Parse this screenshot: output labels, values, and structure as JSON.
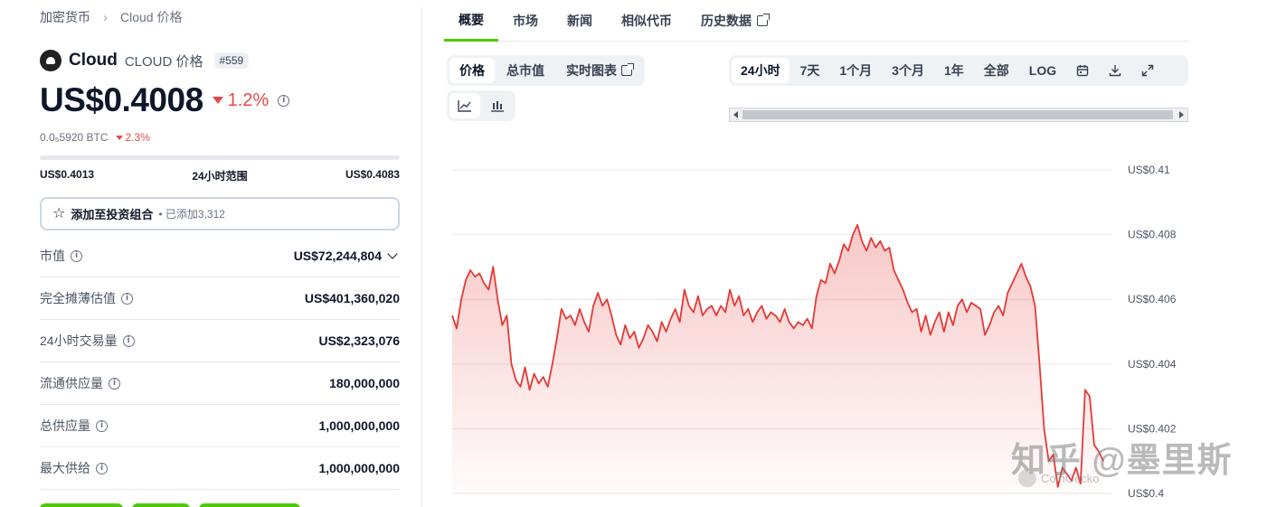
{
  "breadcrumb": {
    "root": "加密货币",
    "current": "Cloud 价格"
  },
  "coin": {
    "name": "Cloud",
    "symbol_label": "CLOUD 价格",
    "rank": "#559"
  },
  "price": {
    "value": "US$0.4008",
    "change_24h": "1.2%"
  },
  "btc": {
    "value": "0.0₅5920 BTC",
    "change": "2.3%"
  },
  "range_24h": {
    "low": "US$0.4013",
    "label": "24小时范围",
    "high": "US$0.4083",
    "progress_fraction": 0.0
  },
  "portfolio": {
    "label": "添加至投资组合",
    "added": "• 已添加3,312"
  },
  "stats": [
    {
      "label": "市值",
      "value": "US$72,244,804"
    },
    {
      "label": "完全摊薄估值",
      "value": "US$401,360,020"
    },
    {
      "label": "24小时交易量",
      "value": "US$2,323,076"
    },
    {
      "label": "流通供应量",
      "value": "180,000,000"
    },
    {
      "label": "总供应量",
      "value": "1,000,000,000"
    },
    {
      "label": "最大供给",
      "value": "1,000,000,000"
    }
  ],
  "tabs": [
    "概要",
    "市场",
    "新闻",
    "相似代币",
    "历史数据"
  ],
  "chart_modes": [
    "价格",
    "总市值",
    "实时图表"
  ],
  "time_ranges": [
    "24小时",
    "7天",
    "1个月",
    "3个月",
    "1年",
    "全部",
    "LOG"
  ],
  "watermark": "知乎 @墨里斯",
  "attribution": "CoinGecko",
  "colors": {
    "accent": "#4bcc00",
    "negative": "#e5484d",
    "line": "#e53935"
  },
  "chart_data": {
    "type": "area",
    "title": "",
    "xlabel": "",
    "ylabel": "",
    "y_ticks": [
      "US$0.41",
      "US$0.408",
      "US$0.406",
      "US$0.404",
      "US$0.402",
      "US$0.4"
    ],
    "ylim": [
      0.4,
      0.41
    ],
    "grid": true,
    "series": [
      {
        "values": [
          0.4055,
          0.4051,
          0.406,
          0.4066,
          0.4069,
          0.4067,
          0.4068,
          0.4065,
          0.4063,
          0.407,
          0.406,
          0.4052,
          0.4055,
          0.404,
          0.4035,
          0.4033,
          0.4039,
          0.4032,
          0.4037,
          0.4034,
          0.4036,
          0.4033,
          0.404,
          0.4048,
          0.4057,
          0.4054,
          0.4055,
          0.4052,
          0.4057,
          0.4053,
          0.405,
          0.4058,
          0.4062,
          0.4058,
          0.406,
          0.4055,
          0.4049,
          0.4046,
          0.4052,
          0.4048,
          0.405,
          0.4045,
          0.4048,
          0.4052,
          0.405,
          0.4047,
          0.4053,
          0.405,
          0.4054,
          0.4057,
          0.4053,
          0.4063,
          0.4058,
          0.4056,
          0.4061,
          0.4055,
          0.4057,
          0.4058,
          0.4055,
          0.4058,
          0.4056,
          0.4063,
          0.4058,
          0.4061,
          0.4055,
          0.4057,
          0.4053,
          0.4056,
          0.4058,
          0.4054,
          0.4056,
          0.4055,
          0.4053,
          0.4057,
          0.4053,
          0.4051,
          0.4053,
          0.4052,
          0.4054,
          0.4051,
          0.4061,
          0.4066,
          0.4065,
          0.4071,
          0.4068,
          0.4072,
          0.4077,
          0.4075,
          0.408,
          0.4083,
          0.4078,
          0.4075,
          0.4079,
          0.4076,
          0.4078,
          0.4075,
          0.4076,
          0.4069,
          0.4066,
          0.4063,
          0.4059,
          0.4056,
          0.4057,
          0.405,
          0.4055,
          0.4049,
          0.4053,
          0.4056,
          0.405,
          0.4056,
          0.4052,
          0.4058,
          0.406,
          0.4056,
          0.4059,
          0.4058,
          0.4057,
          0.4049,
          0.4052,
          0.4056,
          0.4058,
          0.4055,
          0.4062,
          0.4065,
          0.4068,
          0.4071,
          0.4067,
          0.4064,
          0.4058,
          0.404,
          0.402,
          0.401,
          0.4012,
          0.4002,
          0.4008,
          0.4006,
          0.4004,
          0.4008,
          0.4003,
          0.4032,
          0.403,
          0.4015,
          0.4013,
          0.401
        ]
      }
    ]
  }
}
